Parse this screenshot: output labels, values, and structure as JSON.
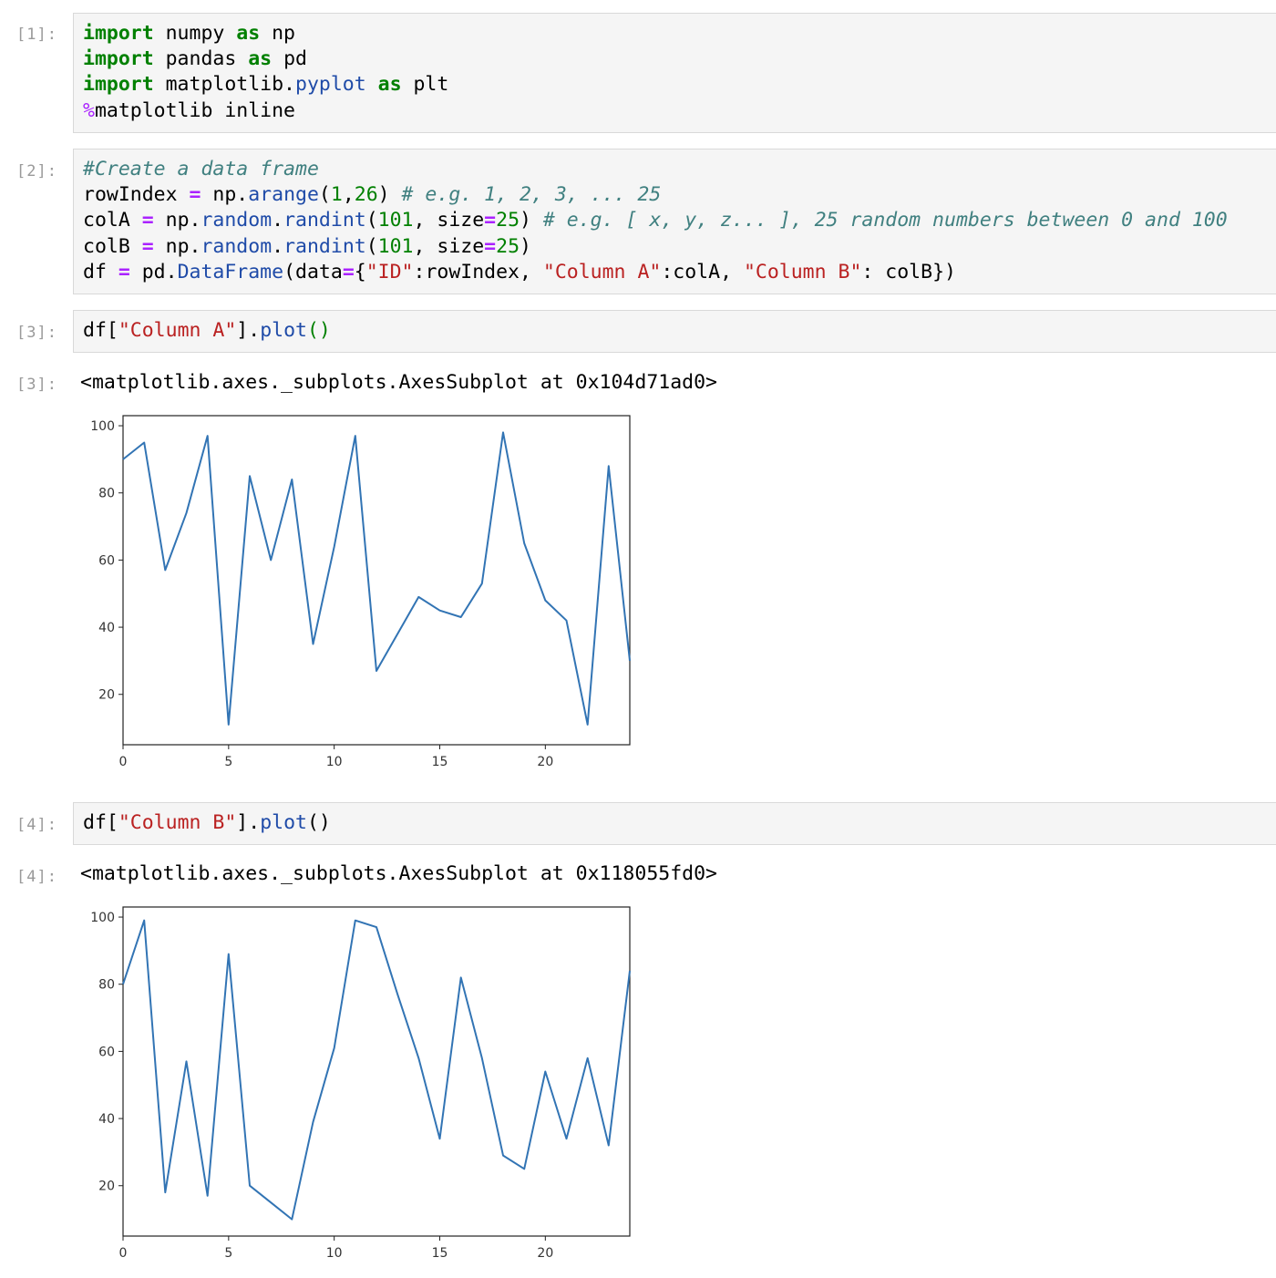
{
  "cells": [
    {
      "prompt": "[1]:",
      "lines": [
        [
          [
            "kw",
            "import"
          ],
          [
            "t",
            " numpy "
          ],
          [
            "kw",
            "as"
          ],
          [
            "t",
            " np"
          ]
        ],
        [
          [
            "kw",
            "import"
          ],
          [
            "t",
            " pandas "
          ],
          [
            "kw",
            "as"
          ],
          [
            "t",
            " pd"
          ]
        ],
        [
          [
            "kw",
            "import"
          ],
          [
            "t",
            " matplotlib."
          ],
          [
            "attr",
            "pyplot"
          ],
          [
            "t",
            " "
          ],
          [
            "kw",
            "as"
          ],
          [
            "t",
            " plt"
          ]
        ],
        [
          [
            "mag",
            "%"
          ],
          [
            "t",
            "matplotlib inline"
          ]
        ]
      ]
    },
    {
      "prompt": "[2]:",
      "lines": [
        [
          [
            "cm",
            "#Create a data frame"
          ]
        ],
        [
          [
            "t",
            "rowIndex "
          ],
          [
            "op",
            "="
          ],
          [
            "t",
            " np."
          ],
          [
            "attr",
            "arange"
          ],
          [
            "t",
            "("
          ],
          [
            "num",
            "1"
          ],
          [
            "t",
            ","
          ],
          [
            "num",
            "26"
          ],
          [
            "t",
            ") "
          ],
          [
            "cm",
            "# e.g. 1, 2, 3, ... 25"
          ]
        ],
        [
          [
            "t",
            "colA "
          ],
          [
            "op",
            "="
          ],
          [
            "t",
            " np."
          ],
          [
            "attr",
            "random"
          ],
          [
            "t",
            "."
          ],
          [
            "attr",
            "randint"
          ],
          [
            "t",
            "("
          ],
          [
            "num",
            "101"
          ],
          [
            "t",
            ", size"
          ],
          [
            "op",
            "="
          ],
          [
            "num",
            "25"
          ],
          [
            "t",
            ") "
          ],
          [
            "cm",
            "# e.g. [ x, y, z... ], 25 random numbers between 0 and 100"
          ]
        ],
        [
          [
            "t",
            "colB "
          ],
          [
            "op",
            "="
          ],
          [
            "t",
            " np."
          ],
          [
            "attr",
            "random"
          ],
          [
            "t",
            "."
          ],
          [
            "attr",
            "randint"
          ],
          [
            "t",
            "("
          ],
          [
            "num",
            "101"
          ],
          [
            "t",
            ", size"
          ],
          [
            "op",
            "="
          ],
          [
            "num",
            "25"
          ],
          [
            "t",
            ")"
          ]
        ],
        [
          [
            "t",
            "df "
          ],
          [
            "op",
            "="
          ],
          [
            "t",
            " pd."
          ],
          [
            "attr",
            "DataFrame"
          ],
          [
            "t",
            "(data"
          ],
          [
            "op",
            "="
          ],
          [
            "t",
            "{"
          ],
          [
            "str",
            "\"ID\""
          ],
          [
            "t",
            ":rowIndex, "
          ],
          [
            "str",
            "\"Column A\""
          ],
          [
            "t",
            ":colA, "
          ],
          [
            "str",
            "\"Column B\""
          ],
          [
            "t",
            ": colB})"
          ]
        ]
      ]
    },
    {
      "prompt": "[3]:",
      "lines": [
        [
          [
            "t",
            "df["
          ],
          [
            "str",
            "\"Column A\""
          ],
          [
            "t",
            "]."
          ],
          [
            "attr",
            "plot"
          ],
          [
            "paren-g",
            "()"
          ]
        ]
      ]
    },
    {
      "prompt": "[4]:",
      "lines": [
        [
          [
            "t",
            "df["
          ],
          [
            "str",
            "\"Column B\""
          ],
          [
            "t",
            "]."
          ],
          [
            "attr",
            "plot"
          ],
          [
            "t",
            "()"
          ]
        ]
      ]
    }
  ],
  "outputs": [
    {
      "prompt": "[3]:",
      "text": "<matplotlib.axes._subplots.AxesSubplot at 0x104d71ad0>"
    },
    {
      "prompt": "[4]:",
      "text": "<matplotlib.axes._subplots.AxesSubplot at 0x118055fd0>"
    }
  ],
  "chart_data": [
    {
      "type": "line",
      "title": "",
      "xlabel": "",
      "ylabel": "",
      "xlim": [
        0,
        24
      ],
      "ylim": [
        5,
        103
      ],
      "x_ticks": [
        0,
        5,
        10,
        15,
        20
      ],
      "y_ticks": [
        20,
        40,
        60,
        80,
        100
      ],
      "grid": false,
      "color": "#3274b4",
      "x": [
        0,
        1,
        2,
        3,
        4,
        5,
        6,
        7,
        8,
        9,
        10,
        11,
        12,
        13,
        14,
        15,
        16,
        17,
        18,
        19,
        20,
        21,
        22,
        23,
        24
      ],
      "values": [
        90,
        95,
        57,
        74,
        97,
        11,
        85,
        60,
        84,
        35,
        64,
        97,
        27,
        38,
        49,
        45,
        43,
        53,
        98,
        65,
        48,
        42,
        11,
        88,
        30
      ]
    },
    {
      "type": "line",
      "title": "",
      "xlabel": "",
      "ylabel": "",
      "xlim": [
        0,
        24
      ],
      "ylim": [
        5,
        103
      ],
      "x_ticks": [
        0,
        5,
        10,
        15,
        20
      ],
      "y_ticks": [
        20,
        40,
        60,
        80,
        100
      ],
      "grid": false,
      "color": "#3274b4",
      "x": [
        0,
        1,
        2,
        3,
        4,
        5,
        6,
        7,
        8,
        9,
        10,
        11,
        12,
        13,
        14,
        15,
        16,
        17,
        18,
        19,
        20,
        21,
        22,
        23,
        24
      ],
      "values": [
        80,
        99,
        18,
        57,
        17,
        89,
        20,
        15,
        10,
        39,
        61,
        99,
        97,
        77,
        58,
        34,
        82,
        58,
        29,
        25,
        54,
        34,
        58,
        32,
        84
      ]
    }
  ]
}
